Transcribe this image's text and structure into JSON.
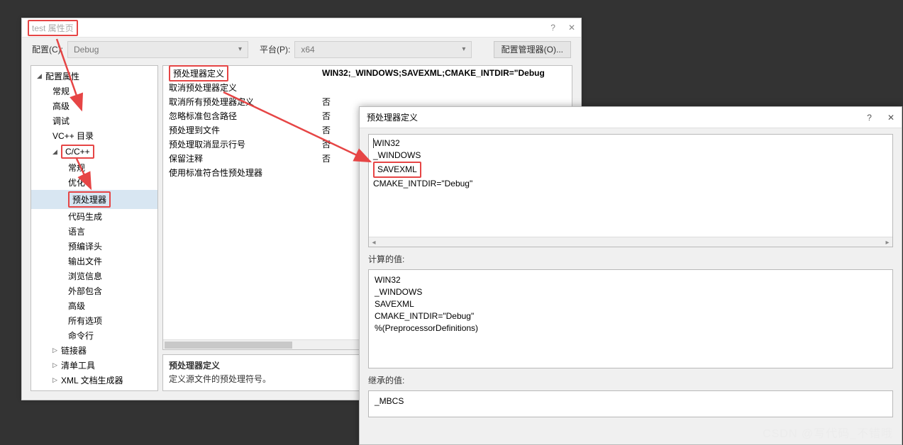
{
  "dialog": {
    "title": "test 属性页",
    "help_glyph": "?",
    "close_glyph": "✕",
    "config_label": "配置(C):",
    "config_value": "Debug",
    "platform_label": "平台(P):",
    "platform_value": "x64",
    "config_manager_btn": "配置管理器(O)..."
  },
  "tree": {
    "root": "配置属性",
    "items_l1": [
      "常规",
      "高级",
      "调试",
      "VC++ 目录"
    ],
    "cpp": "C/C++",
    "cpp_items": [
      "常规",
      "优化",
      "预处理器",
      "代码生成",
      "语言",
      "预编译头",
      "输出文件",
      "浏览信息",
      "外部包含",
      "高级",
      "所有选项",
      "命令行"
    ],
    "after": [
      "链接器",
      "清单工具",
      "XML 文档生成器"
    ]
  },
  "grid": {
    "rows": [
      {
        "label": "预处理器定义",
        "value": "WIN32;_WINDOWS;SAVEXML;CMAKE_INTDIR=\"Debug"
      },
      {
        "label": "取消预处理器定义",
        "value": ""
      },
      {
        "label": "取消所有预处理器定义",
        "value": "否"
      },
      {
        "label": "忽略标准包含路径",
        "value": "否"
      },
      {
        "label": "预处理到文件",
        "value": "否"
      },
      {
        "label": "预处理取消显示行号",
        "value": "否"
      },
      {
        "label": "保留注释",
        "value": "否"
      },
      {
        "label": "使用标准符合性预处理器",
        "value": ""
      }
    ]
  },
  "desc": {
    "heading": "预处理器定义",
    "text": "定义源文件的预处理符号。"
  },
  "editor": {
    "title": "预处理器定义",
    "help_glyph": "?",
    "close_glyph": "✕",
    "lines": [
      "WIN32",
      "_WINDOWS",
      "SAVEXML",
      "CMAKE_INTDIR=\"Debug\""
    ],
    "calc_label": "计算的值:",
    "calc_lines": [
      "WIN32",
      "_WINDOWS",
      "SAVEXML",
      "CMAKE_INTDIR=\"Debug\"",
      "%(PreprocessorDefinitions)"
    ],
    "inherit_label": "继承的值:",
    "inherit_lines": [
      "_MBCS"
    ]
  },
  "watermark": "CSDN @写代码_不错哦"
}
